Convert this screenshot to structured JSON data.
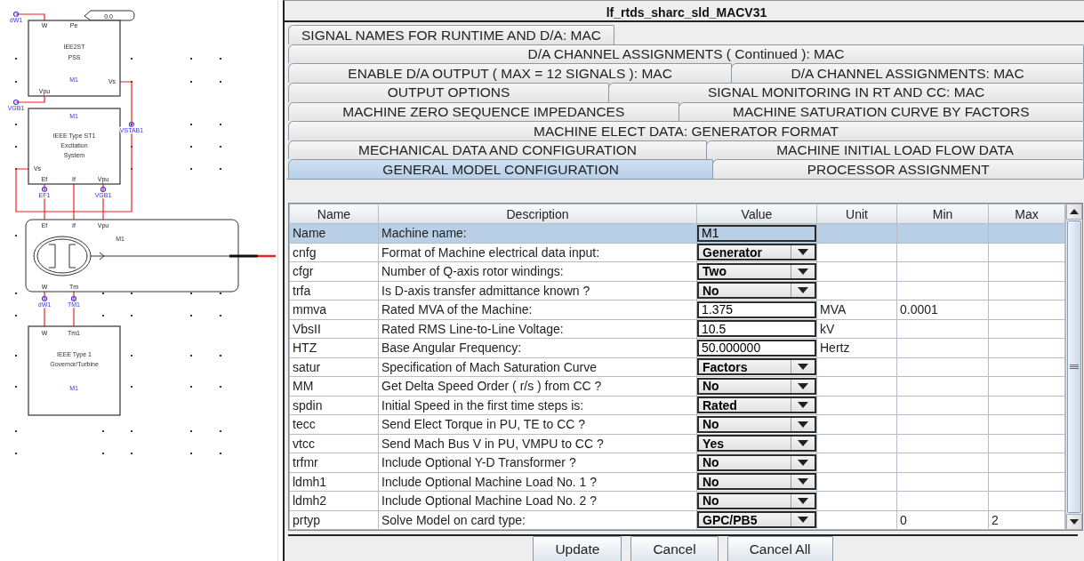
{
  "diagram": {
    "display_value": "0.0",
    "blocks": [
      {
        "kind": "block",
        "lines": [
          "IEE2ST",
          "PSS"
        ],
        "tag": "M1",
        "ports": [
          "W",
          "Pe",
          "Vs",
          "Vpu"
        ]
      },
      {
        "kind": "block",
        "lines": [
          "IEEE Type ST1",
          "Excitation",
          "System"
        ],
        "tag": "M1",
        "ports": [
          "Vs",
          "Ef",
          "If",
          "Vpu"
        ]
      },
      {
        "kind": "machine",
        "tag": "M1",
        "ports": [
          "Ef",
          "If",
          "Vpu",
          "W",
          "Tm"
        ]
      },
      {
        "kind": "block",
        "lines": [
          "IEEE Type 1",
          "Governor/Turbine"
        ],
        "tag": "M1",
        "ports": [
          "W",
          "Tm1"
        ]
      }
    ],
    "signals": [
      "dW1",
      "VGB1",
      "VSTAB1",
      "EF1",
      "VGB1",
      "dW1",
      "TM1"
    ]
  },
  "window": {
    "title": "lf_rtds_sharc_sld_MACV31"
  },
  "tab_rows": [
    [
      {
        "label": "SIGNAL NAMES FOR RUNTIME AND D/A: MAC",
        "selected": false
      }
    ],
    [
      {
        "label": "D/A CHANNEL ASSIGNMENTS ( Continued ): MAC",
        "selected": false
      }
    ],
    [
      {
        "label": "ENABLE D/A OUTPUT ( MAX = 12 SIGNALS ): MAC",
        "selected": false
      },
      {
        "label": "D/A CHANNEL ASSIGNMENTS: MAC",
        "selected": false
      }
    ],
    [
      {
        "label": "OUTPUT OPTIONS",
        "selected": false
      },
      {
        "label": "SIGNAL MONITORING IN RT AND CC: MAC",
        "selected": false
      }
    ],
    [
      {
        "label": "MACHINE ZERO SEQUENCE IMPEDANCES",
        "selected": false
      },
      {
        "label": "MACHINE SATURATION CURVE BY FACTORS",
        "selected": false
      }
    ],
    [
      {
        "label": "MACHINE ELECT DATA:   GENERATOR FORMAT",
        "selected": false
      }
    ],
    [
      {
        "label": "MECHANICAL DATA AND CONFIGURATION",
        "selected": false
      },
      {
        "label": "MACHINE INITIAL LOAD FLOW DATA",
        "selected": false
      }
    ],
    [
      {
        "label": "GENERAL MODEL CONFIGURATION",
        "selected": true
      },
      {
        "label": "PROCESSOR ASSIGNMENT",
        "selected": false
      }
    ]
  ],
  "table": {
    "columns": [
      "Name",
      "Description",
      "Value",
      "Unit",
      "Min",
      "Max"
    ],
    "rows": [
      {
        "name": "Name",
        "description": "Machine name:",
        "kind": "text",
        "value": "M1",
        "selected": true
      },
      {
        "name": "cnfg",
        "description": "Format of Machine electrical data input:",
        "kind": "combo",
        "value": "Generator",
        "selected": false
      },
      {
        "name": "cfgr",
        "description": "Number of Q-axis rotor windings:",
        "kind": "combo",
        "value": "Two",
        "selected": false
      },
      {
        "name": "trfa",
        "description": "Is D-axis transfer admittance known ?",
        "kind": "combo",
        "value": "No",
        "selected": false
      },
      {
        "name": "mmva",
        "description": "Rated MVA of the Machine:",
        "kind": "text",
        "value": "1.375",
        "unit": "MVA",
        "min": "0.0001",
        "selected": false
      },
      {
        "name": "VbsII",
        "description": "Rated RMS Line-to-Line Voltage:",
        "kind": "text",
        "value": "10.5",
        "unit": "kV",
        "selected": false
      },
      {
        "name": "HTZ",
        "description": "Base Angular Frequency:",
        "kind": "text",
        "value": "50.000000",
        "unit": "Hertz",
        "selected": false
      },
      {
        "name": "satur",
        "description": "Specification of Mach Saturation Curve",
        "kind": "combo",
        "value": "Factors",
        "selected": false
      },
      {
        "name": "MM",
        "description": "Get Delta Speed Order ( r/s ) from CC ?",
        "kind": "combo",
        "value": "No",
        "selected": false
      },
      {
        "name": "spdin",
        "description": "Initial Speed in the first time steps is:",
        "kind": "combo",
        "value": "Rated",
        "selected": false
      },
      {
        "name": "tecc",
        "description": "Send Elect Torque in PU, TE to CC ?",
        "kind": "combo",
        "value": "No",
        "selected": false
      },
      {
        "name": "vtcc",
        "description": "Send Mach Bus V in PU, VMPU to CC ?",
        "kind": "combo",
        "value": "Yes",
        "selected": false
      },
      {
        "name": "trfmr",
        "description": "Include Optional Y-D Transformer ?",
        "kind": "combo",
        "value": "No",
        "selected": false
      },
      {
        "name": "ldmh1",
        "description": "Include Optional Machine Load No. 1 ?",
        "kind": "combo",
        "value": "No",
        "selected": false
      },
      {
        "name": "ldmh2",
        "description": "Include Optional Machine Load No. 2 ?",
        "kind": "combo",
        "value": "No",
        "selected": false
      },
      {
        "name": "prtyp",
        "description": "Solve Model on card type:",
        "kind": "combo",
        "value": "GPC/PB5",
        "min": "0",
        "max": "2",
        "selected": false
      }
    ]
  },
  "buttons": [
    "Update",
    "Cancel",
    "Cancel All"
  ]
}
